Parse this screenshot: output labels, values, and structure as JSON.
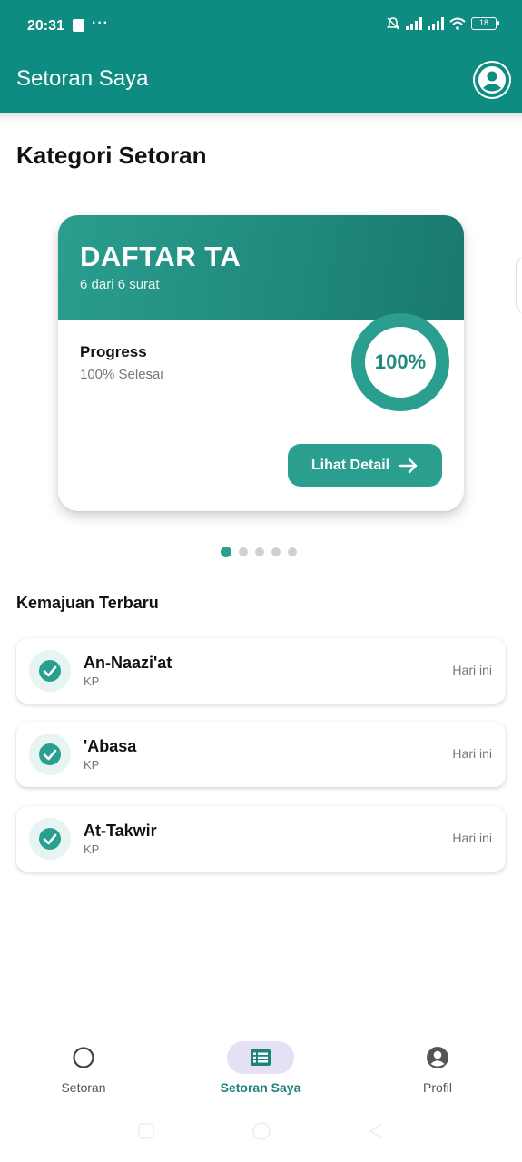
{
  "status_bar": {
    "time": "20:31",
    "extra": "···",
    "battery": "18"
  },
  "app_bar": {
    "title": "Setoran Saya",
    "avatar_icon": "account-circle-icon"
  },
  "section_title": "Kategori Setoran",
  "category_card": {
    "title": "DAFTAR TA",
    "subtitle": "6 dari 6 surat",
    "progress_label": "Progress",
    "progress_status": "100% Selesai",
    "progress_value": "100%",
    "progress_fraction": 1.0,
    "button_label": "Lihat Detail",
    "accent_color": "#2a9e8f"
  },
  "carousel": {
    "count": 5,
    "active_index": 0
  },
  "recent": {
    "title": "Kemajuan Terbaru",
    "items": [
      {
        "name": "An-Naazi'at",
        "type": "KP",
        "time": "Hari ini"
      },
      {
        "name": "'Abasa",
        "type": "KP",
        "time": "Hari ini"
      },
      {
        "name": "At-Takwir",
        "type": "KP",
        "time": "Hari ini"
      }
    ]
  },
  "bottom_nav": {
    "items": [
      {
        "label": "Setoran",
        "icon": "circle-icon"
      },
      {
        "label": "Setoran Saya",
        "icon": "list-icon"
      },
      {
        "label": "Profil",
        "icon": "account-circle-icon"
      }
    ],
    "active_index": 1
  },
  "colors": {
    "primary": "#0f8c81",
    "accent": "#2a9e8f",
    "nav_active_bg": "#e6e0f5"
  }
}
